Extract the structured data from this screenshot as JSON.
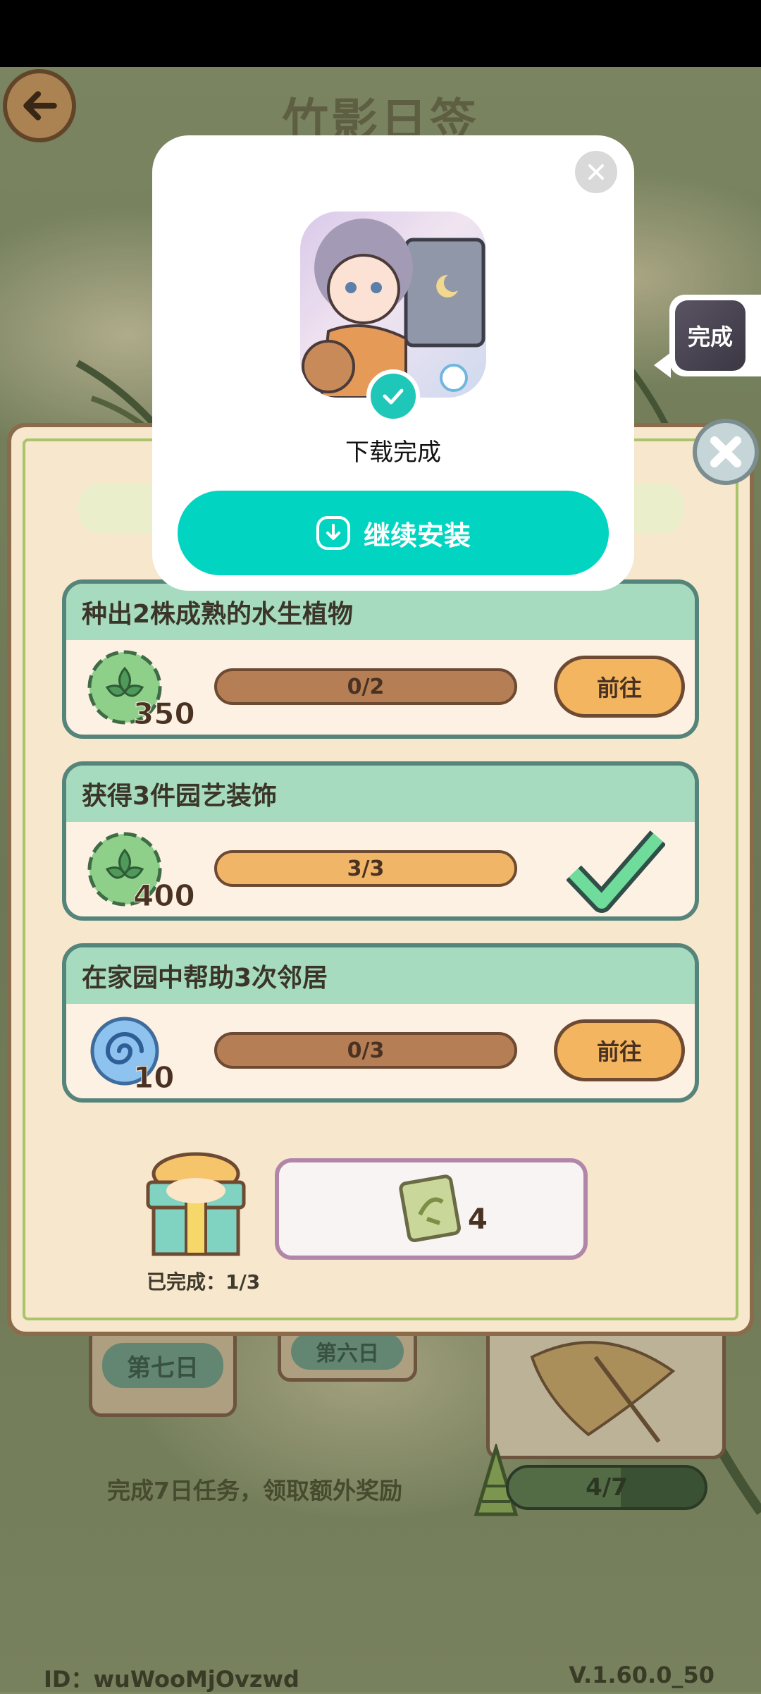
{
  "page": {
    "title": "竹影日签"
  },
  "tasks": [
    {
      "title": "种出2株成熟的水生植物",
      "reward_icon": "leaf-coin-icon",
      "reward": "350",
      "progress_text": "0/2",
      "progress": 0.0,
      "action": "前往",
      "done": false
    },
    {
      "title": "获得3件园艺装饰",
      "reward_icon": "leaf-coin-icon",
      "reward": "400",
      "progress_text": "3/3",
      "progress": 1.0,
      "action": "",
      "done": true
    },
    {
      "title": "在家园中帮助3次邻居",
      "reward_icon": "swirl-orb-icon",
      "reward": "10",
      "progress_text": "0/3",
      "progress": 0.0,
      "action": "前往",
      "done": false
    }
  ],
  "summary": {
    "completed_label": "已完成：1/3",
    "reward_item": "bamboo-ticket-icon",
    "reward_count": "4"
  },
  "week": {
    "day6": "第六日",
    "day7": "第七日",
    "bonus_text": "完成7日任务，领取额外奖励",
    "progress_text": "4/7",
    "progress": 0.571
  },
  "footer": {
    "id": "ID：wuWooMjOvzwd",
    "version": "V.1.60.0_50"
  },
  "download_popup": {
    "status": "下载完成",
    "button": "继续安装"
  },
  "side_bubble": {
    "label": "完成"
  },
  "colors": {
    "accent_teal": "#02d4c2",
    "task_header": "#a6dbbf",
    "button_orange": "#f3b560",
    "panel_bg": "#f6e7cd"
  }
}
